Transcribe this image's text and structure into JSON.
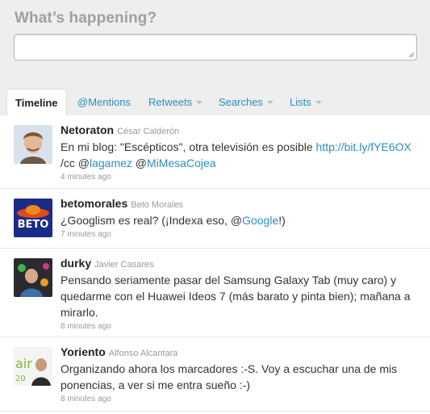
{
  "compose": {
    "question": "What’s happening?",
    "placeholder": ""
  },
  "tabs": [
    {
      "label": "Timeline",
      "active": true
    },
    {
      "label": "@Mentions"
    },
    {
      "label": "Retweets"
    },
    {
      "label": "Searches"
    },
    {
      "label": "Lists"
    }
  ],
  "tweets": [
    {
      "username": "Netoraton",
      "realname": "César Calderón",
      "parts": [
        {
          "t": "En mi blog: \"Escépticos\", otra televisión es posible "
        },
        {
          "a": "http://bit.ly/fYE6OX"
        },
        {
          "t": " /cc @"
        },
        {
          "a": "lagamez"
        },
        {
          "t": " @"
        },
        {
          "a": "MiMesaCojea"
        }
      ],
      "time": "4 minutes ago"
    },
    {
      "username": "betomorales",
      "realname": "Beto Morales",
      "parts": [
        {
          "t": "¿Googlism es real? (¡Indexa eso, @"
        },
        {
          "a": "Google"
        },
        {
          "t": "!)"
        }
      ],
      "time": "7 minutes ago"
    },
    {
      "username": "durky",
      "realname": "Javier Casares",
      "parts": [
        {
          "t": "Pensando seriamente pasar del Samsung Galaxy Tab (muy caro) y quedarme con el Huawei Ideos 7 (más barato y pinta bien); mañana a mirarlo."
        }
      ],
      "time": "8 minutes ago"
    },
    {
      "username": "Yoriento",
      "realname": "Alfonso Alcantara",
      "parts": [
        {
          "t": "Organizando ahora los marcadores :-S. Voy a escuchar una de mis ponencias, a ver si me entra sueño :-)"
        }
      ],
      "time": "8 minutes ago"
    }
  ],
  "colors": {
    "link": "#2a8fbd",
    "background_top": "#eeeeee",
    "muted": "#999999"
  }
}
